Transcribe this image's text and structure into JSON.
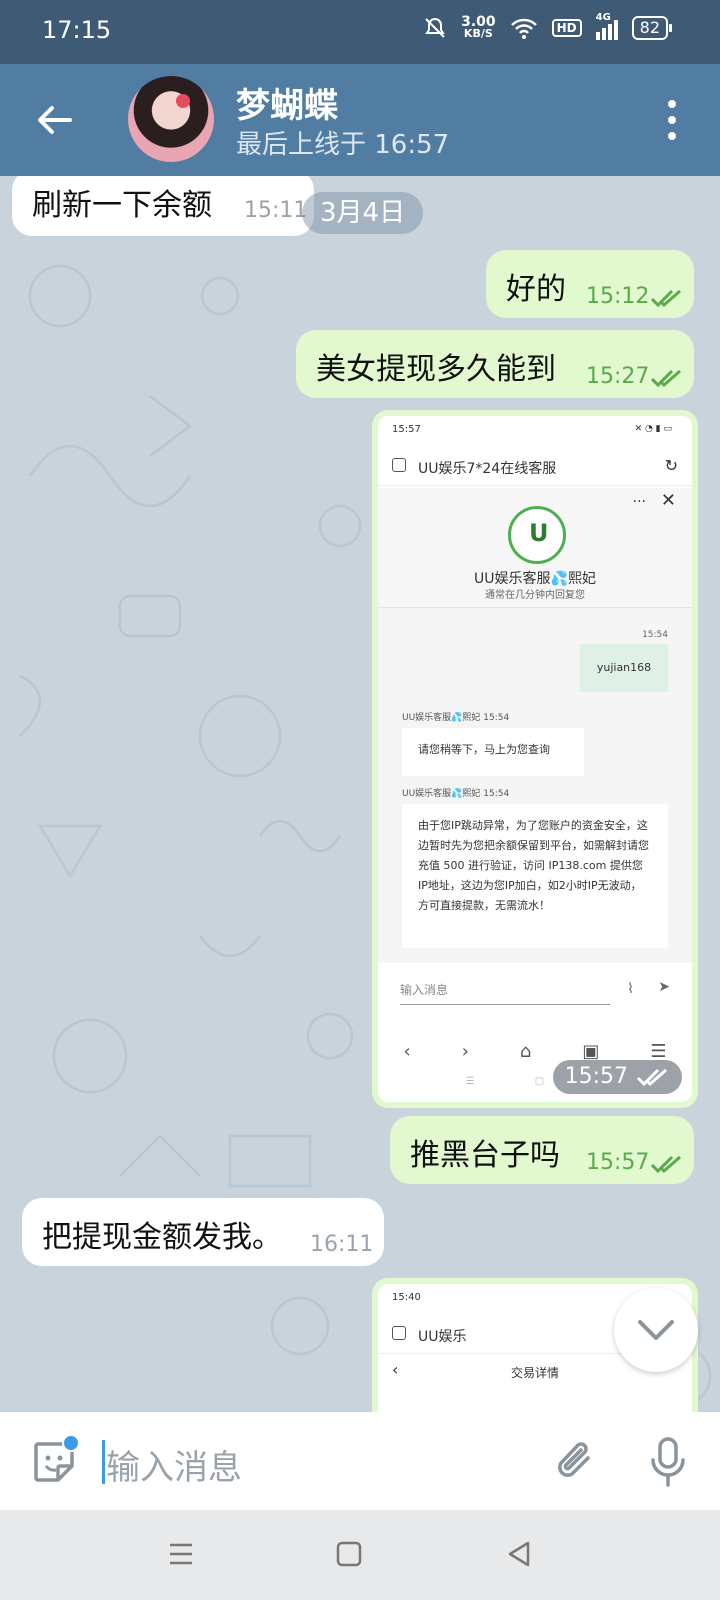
{
  "status_bar": {
    "time": "17:15",
    "net_speed_value": "3.00",
    "net_speed_unit": "KB/S",
    "hd": "HD",
    "network": "4G",
    "battery": "82"
  },
  "header": {
    "title": "梦蝴蝶",
    "subtitle": "最后上线于 16:57"
  },
  "date_pill": "3月4日",
  "messages": [
    {
      "text": "刷新一下余额",
      "time": "15:11"
    },
    {
      "text": "好的",
      "time": "15:12"
    },
    {
      "text": "美女提现多久能到",
      "time": "15:27"
    },
    {
      "time": "15:57"
    },
    {
      "text": "推黑台子吗",
      "time": "15:57"
    },
    {
      "text": "把提现金额发我。",
      "time": "16:11"
    }
  ],
  "screenshot1": {
    "status_time": "15:57",
    "title": "UU娱乐7*24在线客服",
    "agent_name": "UU娱乐客服💦熙妃",
    "reply_note": "通常在几分钟内回复您",
    "sent_time": "15:54",
    "sent_text": "yujian168",
    "meta1": "UU娱乐客服💦熙妃  15:54",
    "msg1": "请您稍等下，马上为您查询",
    "meta2": "UU娱乐客服💦熙妃  15:54",
    "msg2": "由于您IP跳动异常，为了您账户的资金安全，这边暂时先为您把余额保留到平台，如需解封请您充值 500 进行验证，访问 IP138.com 提供您IP地址，这边为您IP加白，如2小时IP无波动，方可直接提款，无需流水！",
    "input_placeholder": "输入消息"
  },
  "screenshot2": {
    "status_time": "15:40",
    "title": "UU娱乐",
    "subtitle": "交易详情"
  },
  "input": {
    "placeholder": "输入消息"
  },
  "colors": {
    "status_bar": "#3f5a75",
    "header": "#527da3",
    "chat_bg": "#c8d3dc",
    "out_bubble": "#e2f8cf",
    "in_bubble": "#ffffff",
    "out_time": "#5ba94c",
    "accent": "#3d9ae8"
  },
  "icons": {
    "back": "arrow-left-icon",
    "menu": "more-vertical-icon",
    "read": "double-check-icon",
    "sticker": "sticker-icon",
    "attach": "paperclip-icon",
    "mic": "microphone-icon",
    "scroll": "chevron-down-icon"
  }
}
